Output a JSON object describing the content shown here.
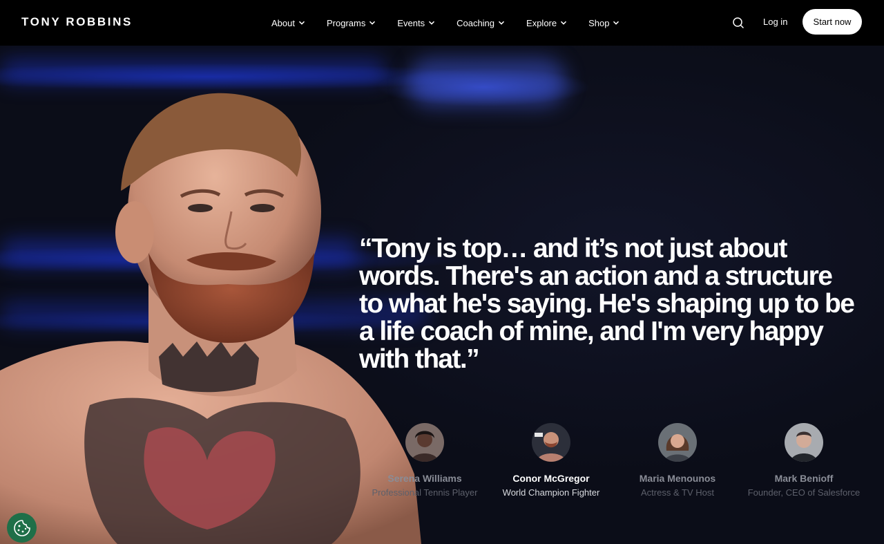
{
  "brand": {
    "logo_text": "TONY ROBBINS"
  },
  "nav": {
    "items": [
      {
        "label": "About"
      },
      {
        "label": "Programs"
      },
      {
        "label": "Events"
      },
      {
        "label": "Coaching"
      },
      {
        "label": "Explore"
      },
      {
        "label": "Shop"
      }
    ],
    "login_label": "Log in",
    "start_label": "Start now"
  },
  "hero": {
    "quote": "“Tony is top… and it’s not just about words. There's an action and a structure to what he's saying. He's shaping up to be a life coach of mine, and I'm very happy with that.”"
  },
  "testimonials": [
    {
      "name": "Serena Williams",
      "role": "Professional Tennis Player",
      "active": false
    },
    {
      "name": "Conor McGregor",
      "role": "World Champion Fighter",
      "active": true
    },
    {
      "name": "Maria Menounos",
      "role": "Actress & TV Host",
      "active": false
    },
    {
      "name": "Mark Benioff",
      "role": "Founder, CEO of Salesforce",
      "active": false
    }
  ],
  "colors": {
    "header_bg": "#000000",
    "hero_bg": "#0b0d18",
    "accent_blue": "#2a45e0",
    "cookie_bg": "#1f6f48"
  },
  "icons": {
    "search": "search-icon",
    "chevron": "chevron-down-icon",
    "cookie": "cookie-icon"
  }
}
